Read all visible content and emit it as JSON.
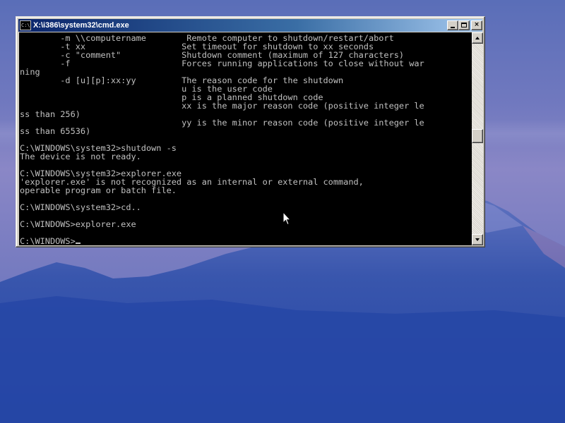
{
  "window": {
    "title": "X:\\i386\\system32\\cmd.exe",
    "icon_label": "C:\\",
    "controls": {
      "minimize": "minimize-icon",
      "maximize": "maximize-icon",
      "close": "×"
    }
  },
  "console": {
    "lines": [
      "        -m \\\\computername        Remote computer to shutdown/restart/abort",
      "        -t xx                   Set timeout for shutdown to xx seconds",
      "        -c \"comment\"            Shutdown comment (maximum of 127 characters)",
      "        -f                      Forces running applications to close without war",
      "ning",
      "        -d [u][p]:xx:yy         The reason code for the shutdown",
      "                                u is the user code",
      "                                p is a planned shutdown code",
      "                                xx is the major reason code (positive integer le",
      "ss than 256)",
      "                                yy is the minor reason code (positive integer le",
      "ss than 65536)",
      "",
      "C:\\WINDOWS\\system32>shutdown -s",
      "The device is not ready.",
      "",
      "C:\\WINDOWS\\system32>explorer.exe",
      "'explorer.exe' is not recognized as an internal or external command,",
      "operable program or batch file.",
      "",
      "C:\\WINDOWS\\system32>cd..",
      "",
      "C:\\WINDOWS>explorer.exe",
      "",
      "C:\\WINDOWS>"
    ],
    "text_color": "#c0c0c0",
    "background_color": "#000000"
  },
  "colors": {
    "title_bar_start": "#0a246a",
    "title_bar_end": "#a6caf0",
    "window_face": "#d4d0c8",
    "desktop_sky": "#7c80c2",
    "desktop_mountain": "#2748a6"
  }
}
